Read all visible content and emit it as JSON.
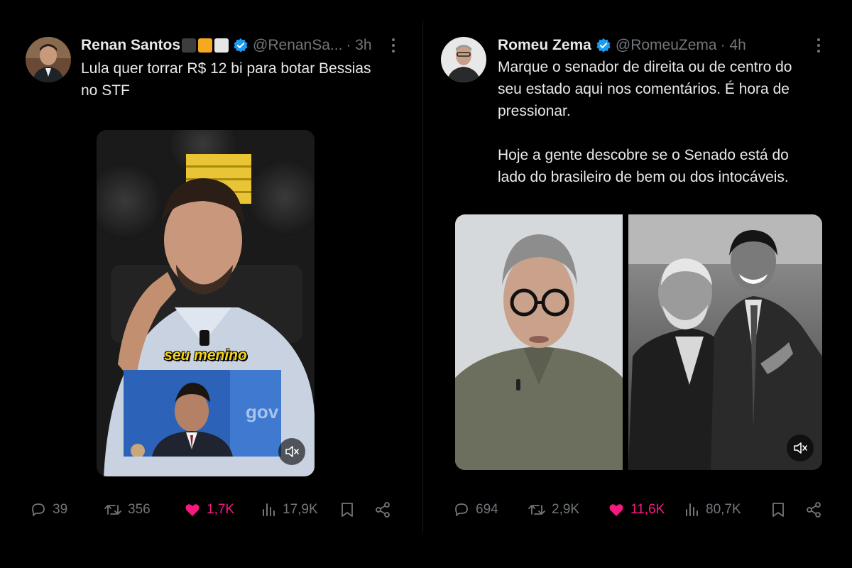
{
  "left": {
    "author": {
      "name": "Renan Santos",
      "handle": "@RenanSa...",
      "time": "· 3h"
    },
    "text": [
      "Lula quer torrar R$ 12 bi para botar Bessias",
      "no STF"
    ],
    "video_caption": "seu menino",
    "inset_logo": "gov",
    "actions": {
      "replies": "39",
      "reposts": "356",
      "likes": "1,7K",
      "views": "17,9K"
    }
  },
  "right": {
    "author": {
      "name": "Romeu Zema",
      "handle": "@RomeuZema",
      "time": "· 4h"
    },
    "text": [
      "Marque o senador de direita ou de centro do",
      "seu estado aqui nos comentários. É hora de",
      "pressionar.",
      "",
      "Hoje a gente descobre se o Senado está do",
      "lado do brasileiro de bem ou dos intocáveis."
    ],
    "actions": {
      "replies": "694",
      "reposts": "2,9K",
      "likes": "11,6K",
      "views": "80,7K"
    }
  },
  "colors": {
    "background": "#000000",
    "text": "#e7e9ea",
    "muted": "#71767b",
    "like": "#f91880",
    "verified": "#1d9bf0"
  },
  "icons": [
    "more-icon",
    "verified-badge-icon",
    "reply-icon",
    "repost-icon",
    "like-icon",
    "views-icon",
    "bookmark-icon",
    "share-icon",
    "mute-icon"
  ]
}
